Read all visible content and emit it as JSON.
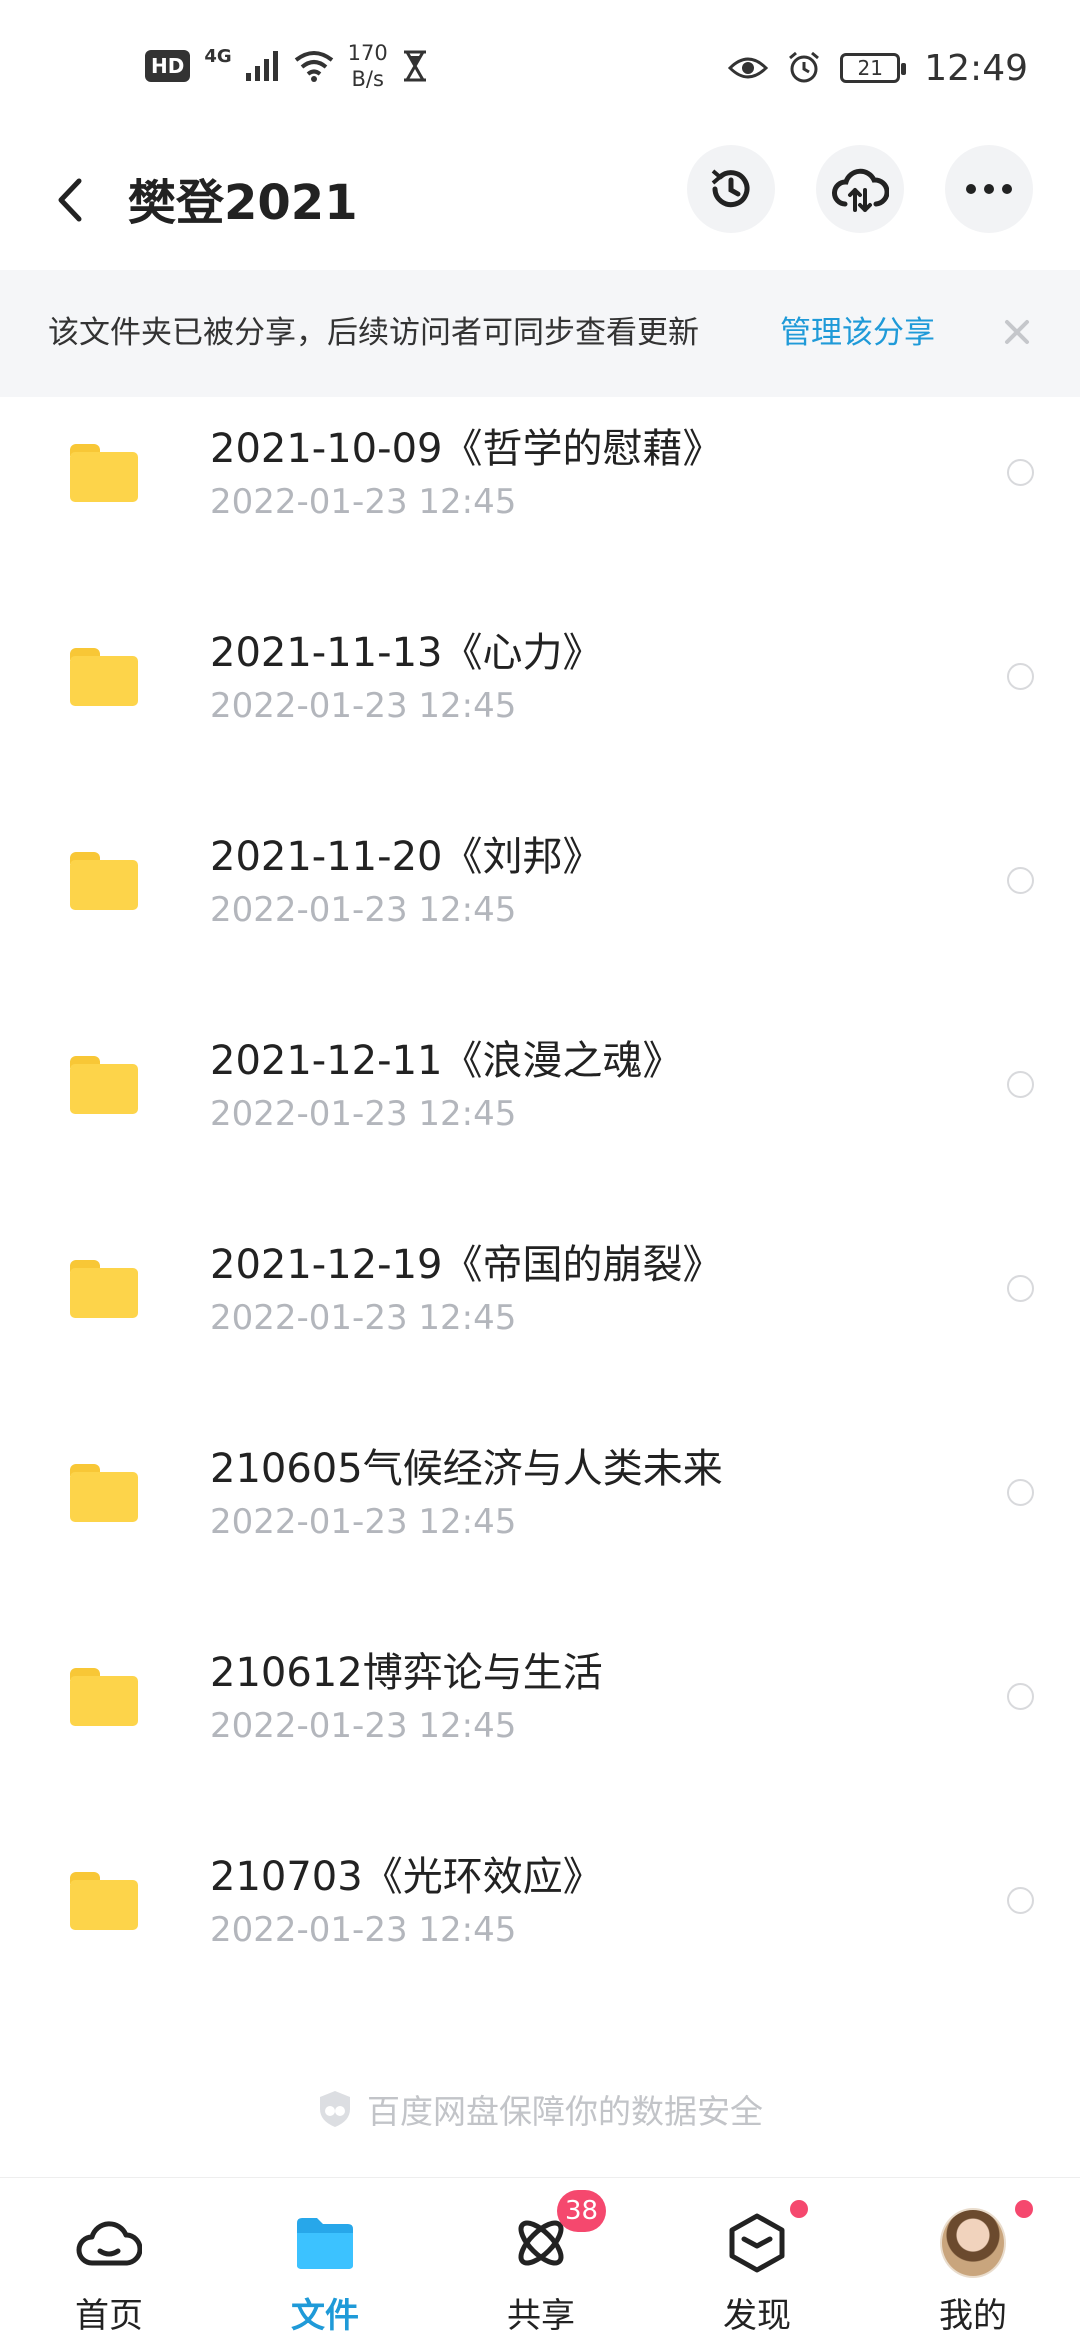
{
  "status_bar": {
    "hd": "HD",
    "network": "4G",
    "speed_value": "170",
    "speed_unit": "B/s",
    "battery": "21",
    "time": "12:49"
  },
  "header": {
    "title": "樊登2021"
  },
  "banner": {
    "text": "该文件夹已被分享，后续访问者可同步查看更新",
    "link": "管理该分享"
  },
  "files": [
    {
      "name": "2021-10-09《哲学的慰藉》",
      "date": "2022-01-23  12:45"
    },
    {
      "name": "2021-11-13《心力》",
      "date": "2022-01-23  12:45"
    },
    {
      "name": "2021-11-20《刘邦》",
      "date": "2022-01-23  12:45"
    },
    {
      "name": "2021-12-11《浪漫之魂》",
      "date": "2022-01-23  12:45"
    },
    {
      "name": "2021-12-19《帝国的崩裂》",
      "date": "2022-01-23  12:45"
    },
    {
      "name": "210605气候经济与人类未来",
      "date": "2022-01-23  12:45"
    },
    {
      "name": "210612博弈论与生活",
      "date": "2022-01-23  12:45"
    },
    {
      "name": "210703《光环效应》",
      "date": "2022-01-23  12:45"
    }
  ],
  "footer_note": "百度网盘保障你的数据安全",
  "bottom_nav": [
    {
      "label": "首页",
      "icon": "cloud-home-icon",
      "active": false
    },
    {
      "label": "文件",
      "icon": "folder-icon",
      "active": true
    },
    {
      "label": "共享",
      "icon": "atom-share-icon",
      "active": false,
      "badge": "38"
    },
    {
      "label": "发现",
      "icon": "cube-discover-icon",
      "active": false,
      "dot": true
    },
    {
      "label": "我的",
      "icon": "avatar-icon",
      "active": false,
      "dot": true
    }
  ],
  "colors": {
    "accent": "#1f9ad8",
    "folder": "#fdd44a",
    "badge": "#f5486e",
    "banner_bg": "#f5f6f8"
  }
}
